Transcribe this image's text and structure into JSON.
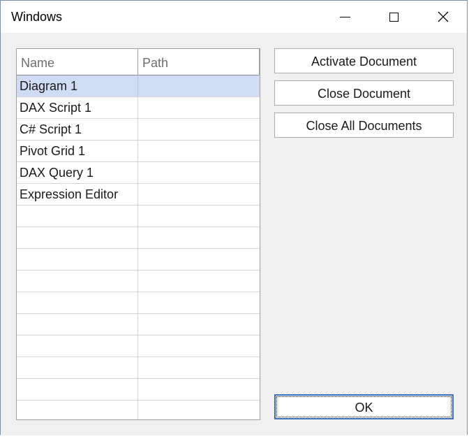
{
  "window": {
    "title": "Windows"
  },
  "titlebar": {
    "minimize_icon": "minimize-icon",
    "maximize_icon": "maximize-icon",
    "close_icon": "close-icon",
    "close_glyph": "✕"
  },
  "grid": {
    "columns": [
      "Name",
      "Path"
    ],
    "rows": [
      {
        "name": "Diagram 1",
        "path": ""
      },
      {
        "name": "DAX Script 1",
        "path": ""
      },
      {
        "name": "C# Script 1",
        "path": ""
      },
      {
        "name": "Pivot Grid 1",
        "path": ""
      },
      {
        "name": "DAX Query 1",
        "path": ""
      },
      {
        "name": "Expression Editor",
        "path": ""
      }
    ],
    "selected_index": 0,
    "selection_color": "#cfdcf3"
  },
  "buttons": {
    "activate": "Activate Document",
    "close": "Close Document",
    "close_all": "Close All Documents",
    "ok": "OK"
  },
  "colors": {
    "accent": "#3b6fc4"
  }
}
